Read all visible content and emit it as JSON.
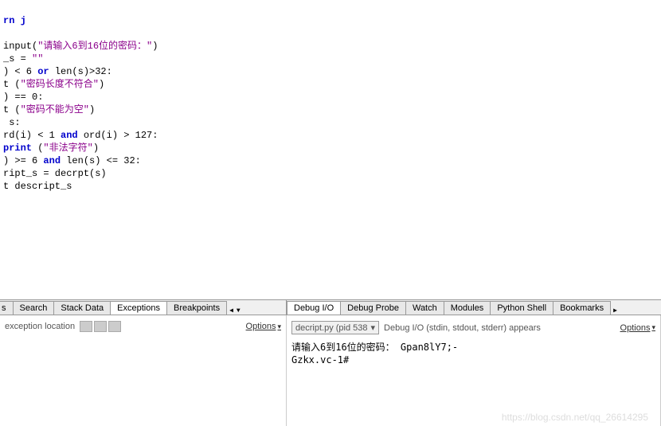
{
  "code": {
    "l1": "rn j",
    "l2": "",
    "l3_pre": "input(",
    "l3_str": "\"请输入6到16位的密码：\"",
    "l3_post": ")",
    "l4": "_s = ",
    "l4_str": "\"\"",
    "l5_a": ") < 6 ",
    "l5_or": "or",
    "l5_b": " len(s)>32:",
    "l6_a": "t (",
    "l6_str": "\"密码长度不符合\"",
    "l6_b": ")",
    "l7": ") == 0:",
    "l8_a": "t (",
    "l8_str": "\"密码不能为空\"",
    "l8_b": ")",
    "l9": " s:",
    "l10_a": "rd(i) < 1 ",
    "l10_and": "and",
    "l10_b": " ord(i) > 127:",
    "l11_a": "print",
    "l11_sp": " (",
    "l11_str": "\"非法字符\"",
    "l11_b": ")",
    "l12_a": ") >= 6 ",
    "l12_and": "and",
    "l12_b": " len(s) <= 32:",
    "l13": "ript_s = decrpt(s)",
    "l14": "t descript_s"
  },
  "tabs_left": {
    "t0": "s",
    "t1": "Search",
    "t2": "Stack Data",
    "t3": "Exceptions",
    "t4": "Breakpoints"
  },
  "tabs_right": {
    "t0": "Debug I/O",
    "t1": "Debug Probe",
    "t2": "Watch",
    "t3": "Modules",
    "t4": "Python Shell",
    "t5": "Bookmarks"
  },
  "left_panel": {
    "label": "exception location",
    "options": "Options"
  },
  "right_panel": {
    "dropdown": "decript.py (pid 538",
    "header_text": "Debug I/O (stdin, stdout, stderr) appears",
    "options": "Options",
    "io_line1": "请输入6到16位的密码： Gpan8lY7;-",
    "io_line2": "Gzkx.vc-1#"
  },
  "watermark": "https://blog.csdn.net/qq_26614295"
}
